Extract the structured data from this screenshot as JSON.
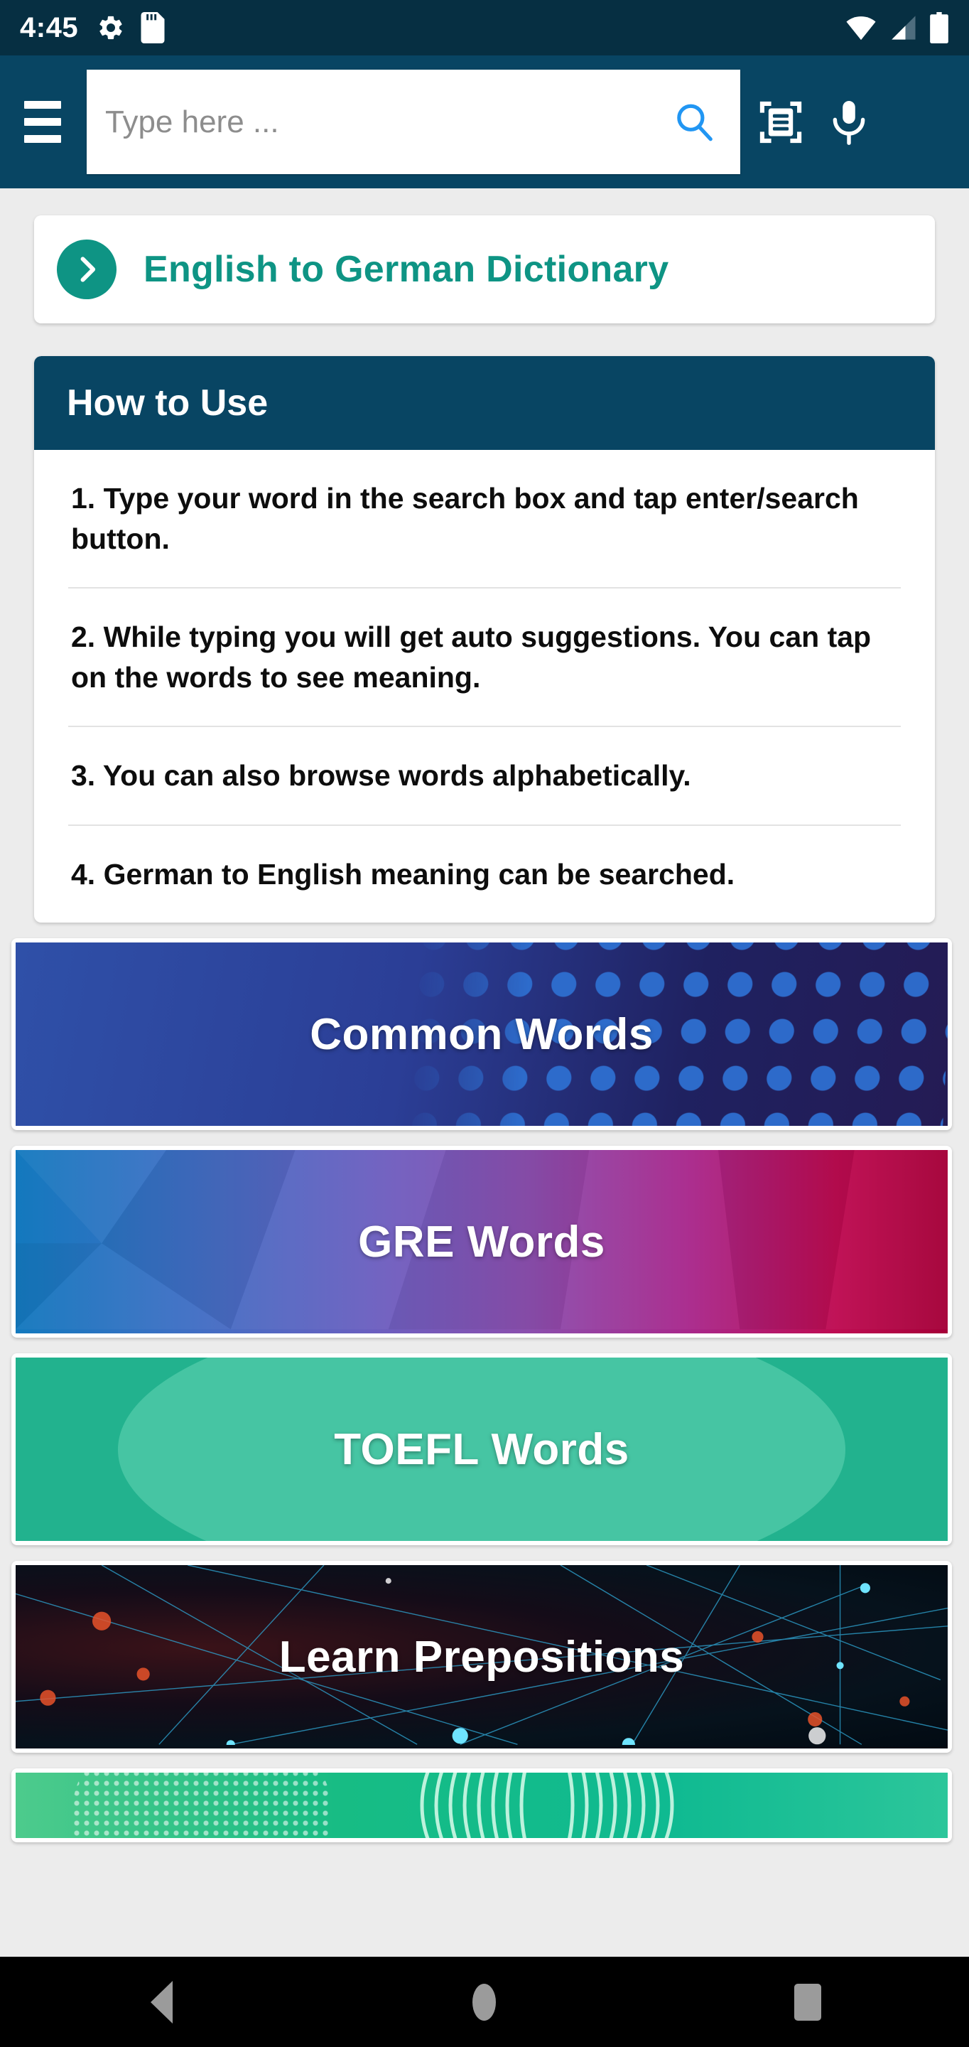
{
  "status_bar": {
    "time": "4:45",
    "left_icons": [
      "gear-icon",
      "sd-card-icon"
    ],
    "right_icons": [
      "wifi-icon",
      "cellular-signal-icon",
      "battery-icon"
    ],
    "background_color": "#062F42"
  },
  "toolbar": {
    "menu_icon": "hamburger-menu-icon",
    "search": {
      "placeholder": "Type here ...",
      "value": "",
      "search_icon": "search-icon",
      "search_icon_color": "#2196F3"
    },
    "scan_icon": "document-scan-icon",
    "voice_icon": "microphone-icon",
    "background_color": "#084563"
  },
  "dictionary_link": {
    "label": "English to German Dictionary",
    "chevron_icon": "chevron-right-icon",
    "accent_color": "#0E9484"
  },
  "how_to_use": {
    "header": "How to Use",
    "header_color": "#084563",
    "items": [
      "1. Type your word in the search box and tap enter/search button.",
      "2. While typing you will get auto suggestions. You can tap on the words to see meaning.",
      "3. You can also browse words alphabetically.",
      "4. German to English meaning can be searched."
    ]
  },
  "banners": [
    {
      "label": "Common Words",
      "art": "blue-dots",
      "accent_color": "#2B3E96"
    },
    {
      "label": "GRE Words",
      "art": "low-poly-gradient",
      "accent_color": "#A8288C"
    },
    {
      "label": "TOEFL Words",
      "art": "teal-blob",
      "accent_color": "#22B28E"
    },
    {
      "label": "Learn Prepositions",
      "art": "dark-network",
      "accent_color": "#06121C"
    },
    {
      "label": "",
      "art": "green-rings",
      "accent_color": "#17BC84"
    }
  ],
  "nav_bar": {
    "back_icon": "back-triangle-icon",
    "home_icon": "home-circle-icon",
    "recents_icon": "recents-square-icon",
    "background_color": "#000000"
  }
}
